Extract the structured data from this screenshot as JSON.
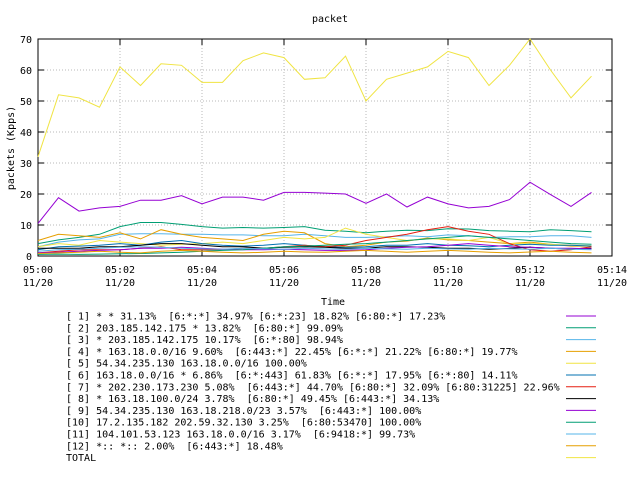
{
  "chart_data": {
    "type": "line",
    "title": "packet",
    "xlabel": "Time",
    "ylabel": "packets (Kpps)",
    "ylim": [
      0,
      70
    ],
    "yticks": [
      0,
      10,
      20,
      30,
      40,
      50,
      60,
      70
    ],
    "xlim": [
      "05:00",
      "05:14"
    ],
    "xticks": [
      {
        "time": "05:00",
        "date": "11/20"
      },
      {
        "time": "05:02",
        "date": "11/20"
      },
      {
        "time": "05:04",
        "date": "11/20"
      },
      {
        "time": "05:06",
        "date": "11/20"
      },
      {
        "time": "05:08",
        "date": "11/20"
      },
      {
        "time": "05:10",
        "date": "11/20"
      },
      {
        "time": "05:12",
        "date": "11/20"
      },
      {
        "time": "05:14",
        "date": "11/20"
      }
    ],
    "grid": true,
    "legend_position": "bottom",
    "x": [
      "05:00",
      "05:00:30",
      "05:01",
      "05:01:30",
      "05:02",
      "05:02:30",
      "05:03",
      "05:03:30",
      "05:04",
      "05:04:30",
      "05:05",
      "05:05:30",
      "05:06",
      "05:06:30",
      "05:07",
      "05:07:30",
      "05:08",
      "05:08:30",
      "05:09",
      "05:09:30",
      "05:10",
      "05:10:30",
      "05:11",
      "05:11:30",
      "05:12",
      "05:12:30",
      "05:13",
      "05:13:30"
    ],
    "series": [
      {
        "name": "[ 1] * * 31.13%  [6:*:*] 34.97% [6:*:23] 18.82% [6:80:*] 17.23%",
        "color": "#9500d3",
        "values": [
          10.5,
          18.8,
          14.5,
          15.5,
          16,
          18,
          18,
          19.5,
          16.8,
          19,
          19,
          18,
          20.5,
          20.5,
          20.3,
          20,
          17,
          20,
          15.8,
          19,
          16.8,
          15.5,
          16,
          18.2,
          23.8,
          19.8,
          16,
          20.5
        ]
      },
      {
        "name": "[ 2] 203.185.142.175 * 13.82%  [6:80:*] 99.09%",
        "color": "#009e73",
        "values": [
          4,
          5.2,
          6,
          7,
          9.5,
          10.8,
          10.8,
          10.2,
          9.5,
          9,
          9.2,
          9,
          9.2,
          9.5,
          8.3,
          8,
          7.5,
          8,
          8.3,
          8.2,
          8.8,
          8.7,
          8.2,
          8,
          7.8,
          8.5,
          8.2,
          7.8
        ]
      },
      {
        "name": "[ 3] * 203.185.142.175 10.17%  [6:*:80] 98.94%",
        "color": "#56b4e9",
        "values": [
          3,
          4.5,
          5.2,
          5.5,
          7,
          7.2,
          7.2,
          7,
          7,
          6.8,
          6.8,
          6.5,
          6.5,
          7,
          6.5,
          6,
          6,
          6.2,
          6.5,
          6.2,
          6.8,
          6.5,
          6,
          6.2,
          6.2,
          6.5,
          6.5,
          6
        ]
      },
      {
        "name": "[ 4] * 163.18.0.0/16 9.60%  [6:443:*] 22.45% [6:*:*] 21.22% [6:80:*] 19.77%",
        "color": "#e69f00",
        "values": [
          5,
          7,
          6.5,
          6,
          7.5,
          5.5,
          8.5,
          7,
          6,
          5.5,
          5,
          7,
          8,
          7.5,
          4,
          3,
          3.5,
          4.5,
          4.8,
          5.8,
          5.2,
          5,
          4.5,
          4,
          4.5,
          3.8,
          3.2,
          3.2
        ]
      },
      {
        "name": "[ 5] 54.34.235.130 163.18.0.0/16 100.00%",
        "color": "#f0e442",
        "values": [
          3,
          4,
          3.5,
          5,
          4.5,
          4,
          3.5,
          3.8,
          4,
          4.5,
          4,
          5,
          6,
          5.5,
          6,
          9,
          7,
          6,
          5,
          5.5,
          5.5,
          5,
          6,
          4,
          4,
          3.8,
          3.5,
          3.3
        ]
      },
      {
        "name": "[ 6] 163.18.0.0/16 * 6.86%  [6:*:443] 61.83% [6:*:*] 17.95% [6:*:80] 14.11%",
        "color": "#0072b2",
        "values": [
          2,
          3,
          3.2,
          3.5,
          4,
          3.5,
          4.5,
          5,
          4,
          3.5,
          3.2,
          3.5,
          4,
          3.5,
          3,
          2.8,
          3,
          3.5,
          3.5,
          4,
          3.5,
          3.3,
          3,
          3.5,
          3.8,
          3.5,
          3.5,
          3.2
        ]
      },
      {
        "name": "[ 7] * 202.230.173.230 5.08%  [6:443:*] 44.70% [6:80:*] 32.09% [6:80:31225] 22.96%",
        "color": "#e51e10",
        "values": [
          1,
          1.5,
          2,
          2,
          2,
          2.5,
          3,
          2,
          2,
          2,
          2.5,
          2.5,
          3,
          3.5,
          3,
          3.5,
          5,
          6,
          7,
          8.5,
          9.5,
          8,
          7,
          4,
          2,
          1.5,
          2,
          3
        ]
      },
      {
        "name": "[ 8] * 163.18.100.0/24 3.78%  [6:80:*] 49.45% [6:443:*] 34.13%",
        "color": "#000000",
        "values": [
          2.5,
          2.5,
          2.5,
          3,
          3,
          3.5,
          4,
          4,
          3.5,
          3,
          3,
          2.5,
          2.8,
          3,
          2.8,
          2.5,
          2.5,
          3,
          3,
          2.8,
          2.5,
          2.5,
          2.2,
          2.5,
          2.8,
          2.5,
          2.2,
          2.5
        ]
      },
      {
        "name": "[ 9] 54.34.235.130 163.18.218.0/23 3.57%  [6:443:*] 100.00%",
        "color": "#9500d3",
        "values": [
          1,
          1.2,
          1.5,
          1.8,
          2,
          2.5,
          2.5,
          2.8,
          2.5,
          2.2,
          2,
          2,
          2.2,
          2,
          1.8,
          1.8,
          2,
          2.5,
          2.8,
          3,
          3.5,
          4,
          3.5,
          3,
          2.8,
          2.5,
          2.5,
          2.3
        ]
      },
      {
        "name": "[10] 17.2.135.182 202.59.32.130 3.25%  [6:80:53470] 100.00%",
        "color": "#009e73",
        "values": [
          0.5,
          0.6,
          0.5,
          0.6,
          0.7,
          0.8,
          1,
          1.2,
          1.5,
          1.8,
          2,
          2.5,
          3,
          3.2,
          3.5,
          3.8,
          4,
          4.5,
          5,
          5.5,
          6,
          6.5,
          6,
          5.5,
          5,
          4.5,
          4,
          3.8
        ]
      },
      {
        "name": "[11] 104.101.53.123 163.18.0.0/16 3.17%  [6:9418:*] 99.73%",
        "color": "#56b4e9",
        "values": [
          1.5,
          2,
          2.2,
          2.5,
          2.8,
          3,
          2.8,
          2.5,
          2.3,
          2.2,
          2.5,
          2.3,
          2.2,
          2.5,
          2.3,
          2.2,
          2.5,
          2.3,
          2.2,
          2.5,
          2.3,
          2.2,
          2.5,
          2.3,
          2.2,
          2.5,
          2.2,
          2
        ]
      },
      {
        "name": "[12] *:: *:: 2.00%  [6:443:*] 18.48%",
        "color": "#e69f00",
        "values": [
          0.8,
          1,
          1.2,
          1.5,
          1.2,
          1,
          1.5,
          1.8,
          1.5,
          1.2,
          1,
          1.2,
          1.5,
          1.3,
          1.2,
          1.5,
          1.8,
          1.5,
          1.2,
          1.5,
          1.8,
          1.5,
          1.2,
          1,
          1.3,
          1.5,
          1.2,
          1
        ]
      },
      {
        "name": "TOTAL",
        "color": "#f0e442",
        "values": [
          32,
          52,
          51,
          48,
          61,
          55,
          62,
          61.5,
          56,
          56,
          63,
          65.5,
          64,
          57,
          57.5,
          64.5,
          50,
          57,
          59,
          61,
          66,
          64,
          55,
          61.5,
          70,
          60,
          51,
          58
        ]
      }
    ]
  }
}
